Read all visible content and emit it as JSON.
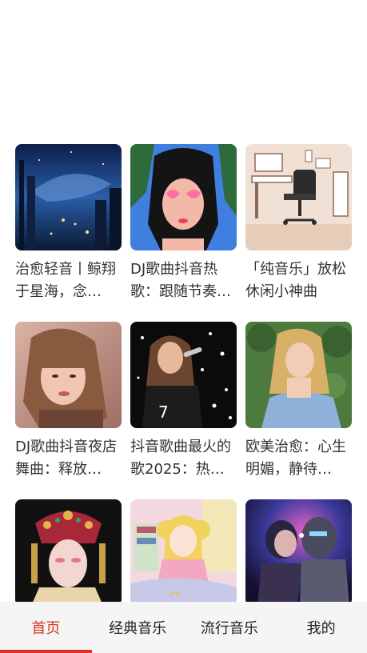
{
  "playlists": [
    {
      "title": "治愈轻音丨鲸翔于星海，念…",
      "cover_icon": "night-city-whale-cover",
      "accent": "#1c3f7a"
    },
    {
      "title": "DJ歌曲抖音热歌：跟随节奏…",
      "cover_icon": "heart-glasses-girl-cover",
      "accent": "#e45a8a"
    },
    {
      "title": "「纯音乐」放松休闲小神曲",
      "cover_icon": "desk-chair-illustration-cover",
      "accent": "#e9d3c2"
    },
    {
      "title": "DJ歌曲抖音夜店舞曲：释放…",
      "cover_icon": "portrait-woman-bangs-cover",
      "accent": "#b88a78"
    },
    {
      "title": "抖音歌曲最火的歌2025：热…",
      "cover_icon": "singer-microphone-cover",
      "accent": "#1a1a1a"
    },
    {
      "title": "欧美治愈：心生明媚，静待…",
      "cover_icon": "blonde-woman-garden-cover",
      "accent": "#6b8f5a"
    },
    {
      "title": "",
      "cover_icon": "opera-headdress-cover",
      "accent": "#8a1e2a"
    },
    {
      "title": "",
      "cover_icon": "anime-girl-room-cover",
      "accent": "#f0c8d0"
    },
    {
      "title": "",
      "cover_icon": "robot-couple-cover",
      "accent": "#3a2a6a"
    }
  ],
  "tabbar": {
    "tabs": [
      {
        "label": "首页",
        "active": true
      },
      {
        "label": "经典音乐",
        "active": false
      },
      {
        "label": "流行音乐",
        "active": false
      },
      {
        "label": "我的",
        "active": false
      }
    ],
    "active_color": "#d8341e"
  }
}
